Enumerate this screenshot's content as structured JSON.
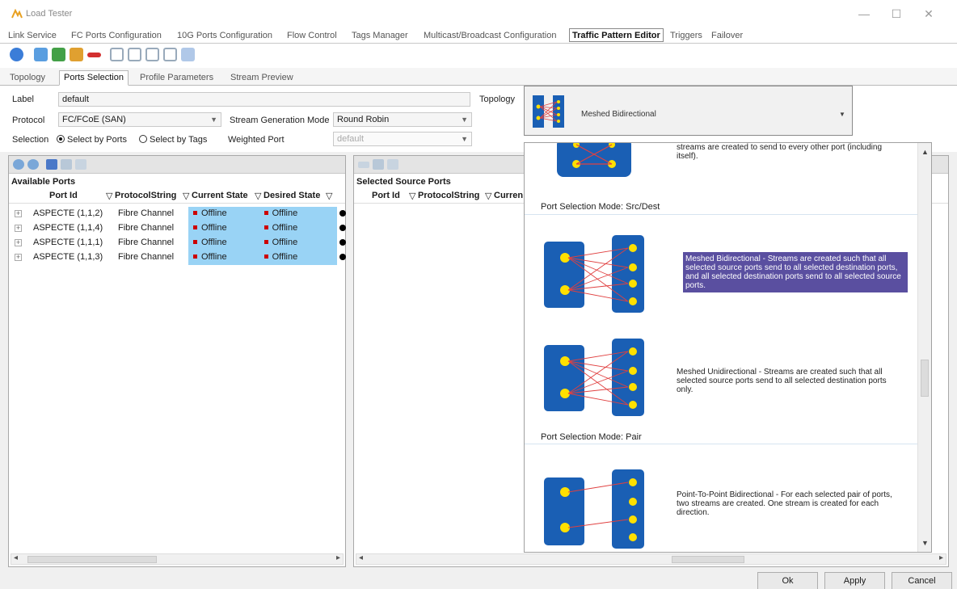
{
  "window": {
    "title": "Load Tester",
    "minimize": "—",
    "maximize": "☐",
    "close": "✕"
  },
  "main_tabs": [
    {
      "label": "Link Service"
    },
    {
      "label": "FC Ports Configuration"
    },
    {
      "label": "10G Ports Configuration"
    },
    {
      "label": "Flow Control"
    },
    {
      "label": "Tags Manager"
    },
    {
      "label": "Multicast/Broadcast Configuration"
    },
    {
      "label": "Traffic Pattern Editor",
      "active": true
    },
    {
      "label": "Triggers"
    },
    {
      "label": "Failover"
    }
  ],
  "toolbar_icons": [
    "new-icon",
    "open-icon",
    "save-icon",
    "save-as-icon",
    "remove-icon",
    "copy-icon",
    "paste-icon",
    "view-icon",
    "view2-icon",
    "options-icon"
  ],
  "sub_tabs": [
    {
      "label": "Topology"
    },
    {
      "label": "Ports Selection",
      "active": true
    },
    {
      "label": "Profile Parameters"
    },
    {
      "label": "Stream Preview"
    }
  ],
  "form": {
    "label_caption": "Label",
    "label_value": "default",
    "topology_caption": "Topology",
    "protocol_caption": "Protocol",
    "protocol_value": "FC/FCoE (SAN)",
    "stream_mode_caption": "Stream Generation Mode",
    "stream_mode_value": "Round Robin",
    "selection_caption": "Selection",
    "select_by_ports": "Select by Ports",
    "select_by_tags": "Select by Tags",
    "weighted_port_caption": "Weighted Port",
    "weighted_port_value": "default"
  },
  "topology_dropdown": {
    "selected": "Meshed Bidirectional"
  },
  "available_ports": {
    "title": "Available Ports",
    "columns": [
      "Port Id",
      "ProtocolString",
      "Current State",
      "Desired State"
    ],
    "rows": [
      {
        "port": "ASPECTE (1,1,2)",
        "protocol": "Fibre Channel",
        "current": "Offline",
        "desired": "Offline"
      },
      {
        "port": "ASPECTE (1,1,4)",
        "protocol": "Fibre Channel",
        "current": "Offline",
        "desired": "Offline"
      },
      {
        "port": "ASPECTE (1,1,1)",
        "protocol": "Fibre Channel",
        "current": "Offline",
        "desired": "Offline"
      },
      {
        "port": "ASPECTE (1,1,3)",
        "protocol": "Fibre Channel",
        "current": "Offline",
        "desired": "Offline"
      }
    ]
  },
  "selected_ports": {
    "title": "Selected Source Ports",
    "columns": [
      "Port Id",
      "ProtocolString",
      "Curren"
    ]
  },
  "topology_popup": {
    "top_text": "streams are created to send to every other port (including itself).",
    "mode_src_dest": "Port Selection Mode: Src/Dest",
    "meshed_bi": "Meshed Bidirectional - Streams are created such that all selected source ports send to all selected destination ports, and all selected destination ports send to all selected source ports.",
    "meshed_uni": "Meshed Unidirectional - Streams are created such that all selected source ports send to all selected destination ports only.",
    "mode_pair": "Port Selection Mode: Pair",
    "p2p_bi": "Point-To-Point Bidirectional - For each selected pair of ports, two streams are created.  One stream is created for each direction."
  },
  "buttons": {
    "ok": "Ok",
    "apply": "Apply",
    "cancel": "Cancel"
  },
  "colors": {
    "selection_purple": "#5a4fa0",
    "row_highlight": "#99d3f5",
    "offline_red": "#cc0000"
  }
}
